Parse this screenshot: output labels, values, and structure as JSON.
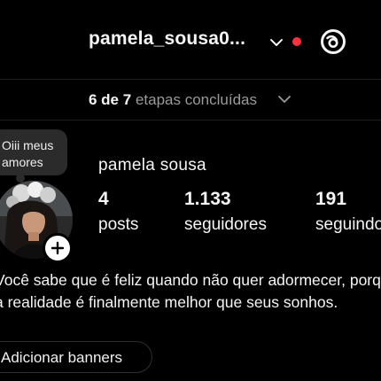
{
  "header": {
    "username": "pamela_sousa0...",
    "chevron_icon": "chevron-down-icon",
    "notification_color": "#ff3040",
    "threads_icon": "threads-icon"
  },
  "steps": {
    "completed": "6 de 7",
    "rest": "etapas concluídas"
  },
  "note": {
    "line1": "Oiii meus",
    "line2": "amores"
  },
  "profile": {
    "name": "pamela sousa",
    "stats": {
      "posts": {
        "value": "4",
        "label": "posts"
      },
      "followers": {
        "value": "1.133",
        "label": "seguidores"
      },
      "following": {
        "value": "191",
        "label": "seguindo"
      }
    }
  },
  "bio": {
    "line1": "Você sabe que é feliz quando não quer adormecer, porque",
    "line2": "a realidade é finalmente melhor que seus sonhos."
  },
  "actions": {
    "banners_label": "Adicionar banners"
  },
  "colors": {
    "background": "#000000",
    "text": "#f5f5f5",
    "muted": "#9a9a9a",
    "bubble": "#2b2b2b",
    "accent_red": "#ff3040"
  }
}
